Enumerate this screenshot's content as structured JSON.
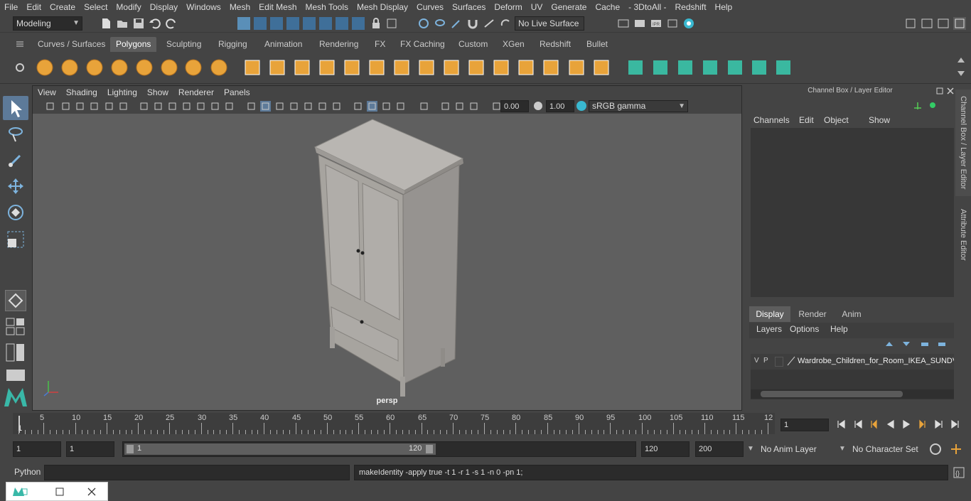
{
  "menubar": {
    "items": [
      "File",
      "Edit",
      "Create",
      "Select",
      "Modify",
      "Display",
      "Windows",
      "Mesh",
      "Edit Mesh",
      "Mesh Tools",
      "Mesh Display",
      "Curves",
      "Surfaces",
      "Deform",
      "UV",
      "Generate",
      "Cache",
      "- 3DtoAll -",
      "Redshift",
      "Help"
    ]
  },
  "status": {
    "mode": "Modeling",
    "live_surface": "No Live Surface"
  },
  "shelf": {
    "tabs": [
      "Curves / Surfaces",
      "Polygons",
      "Sculpting",
      "Rigging",
      "Animation",
      "Rendering",
      "FX",
      "FX Caching",
      "Custom",
      "XGen",
      "Redshift",
      "Bullet"
    ],
    "active": "Polygons"
  },
  "viewport": {
    "menu": [
      "View",
      "Shading",
      "Lighting",
      "Show",
      "Renderer",
      "Panels"
    ],
    "exposure": "0.00",
    "gamma": "1.00",
    "colorspace": "sRGB gamma",
    "camera_label": "persp"
  },
  "channel_box": {
    "title": "Channel Box / Layer Editor",
    "menu": [
      "Channels",
      "Edit",
      "Object",
      "Show"
    ],
    "side_tab_1": "Channel Box / Layer Editor",
    "side_tab_2": "Attribute Editor"
  },
  "layer_editor": {
    "tabs": [
      "Display",
      "Render",
      "Anim"
    ],
    "active_tab": "Display",
    "menu": [
      "Layers",
      "Options",
      "Help"
    ],
    "layer": {
      "v": "V",
      "p": "P",
      "name": "Wardrobe_Children_for_Room_IKEA_SUNDVIK"
    }
  },
  "timeline": {
    "ticks": [
      "5",
      "10",
      "15",
      "20",
      "25",
      "30",
      "35",
      "40",
      "45",
      "50",
      "55",
      "60",
      "65",
      "70",
      "75",
      "80",
      "85",
      "90",
      "95",
      "100",
      "105",
      "110",
      "115",
      "12"
    ],
    "current_frame_marker": "1",
    "current_frame_field": "1"
  },
  "range": {
    "start": "1",
    "start_inner": "1",
    "slider_start": "1",
    "slider_end": "120",
    "end": "120",
    "max_end": "200",
    "anim_layer": "No Anim Layer",
    "character_set": "No Character Set"
  },
  "command": {
    "language": "Python",
    "result": "makeIdentity -apply true -t 1 -r 1 -s 1 -n 0 -pn 1;"
  },
  "colors": {
    "accent_orange": "#e8a33a",
    "teal": "#39b8a8",
    "panel": "#444444",
    "viewport_bg": "#5f5f5f"
  }
}
